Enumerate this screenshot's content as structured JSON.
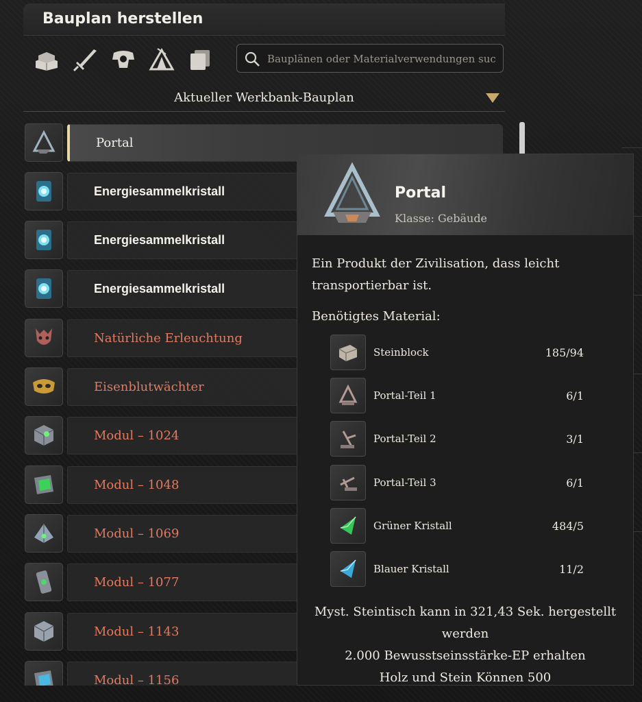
{
  "window": {
    "title": "Bauplan herstellen"
  },
  "categories": [
    {
      "icon": "building-blocks-icon"
    },
    {
      "icon": "weapon-icon"
    },
    {
      "icon": "armor-icon"
    },
    {
      "icon": "camp-tent-icon"
    },
    {
      "icon": "cards-icon"
    }
  ],
  "search": {
    "placeholder": "Bauplänen oder Materialverwendungen suc"
  },
  "dropdown": {
    "selected": "Aktueller Werkbank-Bauplan"
  },
  "blueprints": [
    {
      "label": "Portal",
      "style": "normal",
      "icon": "portal-icon",
      "selected": true
    },
    {
      "label": "Energiesammelkristall",
      "style": "normal",
      "icon": "crystal-card-icon"
    },
    {
      "label": "Energiesammelkristall",
      "style": "normal",
      "icon": "crystal-card-icon"
    },
    {
      "label": "Energiesammelkristall",
      "style": "normal",
      "icon": "crystal-card-icon"
    },
    {
      "label": "Natürliche Erleuchtung",
      "style": "red",
      "icon": "mask-icon"
    },
    {
      "label": "Eisenblutwächter",
      "style": "red",
      "icon": "golden-mask-icon"
    },
    {
      "label": "Modul – 1024",
      "style": "red",
      "icon": "module-cube-icon"
    },
    {
      "label": "Modul – 1048",
      "style": "red",
      "icon": "module-scroll-icon"
    },
    {
      "label": "Modul – 1069",
      "style": "red",
      "icon": "module-pyramid-icon"
    },
    {
      "label": "Modul – 1077",
      "style": "red",
      "icon": "module-chip-icon"
    },
    {
      "label": "Modul – 1143",
      "style": "red",
      "icon": "module-cube-icon"
    },
    {
      "label": "Modul – 1156",
      "style": "red",
      "icon": "module-scroll-icon"
    }
  ],
  "tooltip": {
    "name": "Portal",
    "class": "Klasse: Gebäude",
    "description_line1": "Ein Produkt der Zivilisation, dass leicht",
    "description_line2": "transportierbar ist.",
    "materials_heading": "Benötigtes Material:",
    "materials": [
      {
        "name": "Steinblock",
        "qty": "185/94",
        "icon": "stone-block-icon"
      },
      {
        "name": "Portal-Teil 1",
        "qty": "6/1",
        "icon": "portal-part-icon"
      },
      {
        "name": "Portal-Teil 2",
        "qty": "3/1",
        "icon": "portal-part-icon"
      },
      {
        "name": "Portal-Teil 3",
        "qty": "6/1",
        "icon": "portal-part-icon"
      },
      {
        "name": "Grüner Kristall",
        "qty": "484/5",
        "icon": "green-crystal-icon"
      },
      {
        "name": "Blauer Kristall",
        "qty": "11/2",
        "icon": "blue-crystal-icon"
      }
    ],
    "footer_line1": "Myst. Steintisch kann in 321,43 Sek. hergestellt",
    "footer_line2": "werden",
    "footer_line3": "2.000 Bewusstseinsstärke-EP erhalten",
    "footer_line4": "Holz und Stein Können 500"
  },
  "colors": {
    "accent_gold": "#c9a96b",
    "unavailable_red": "#e07b62",
    "selected_marker": "#e8d9a8"
  }
}
